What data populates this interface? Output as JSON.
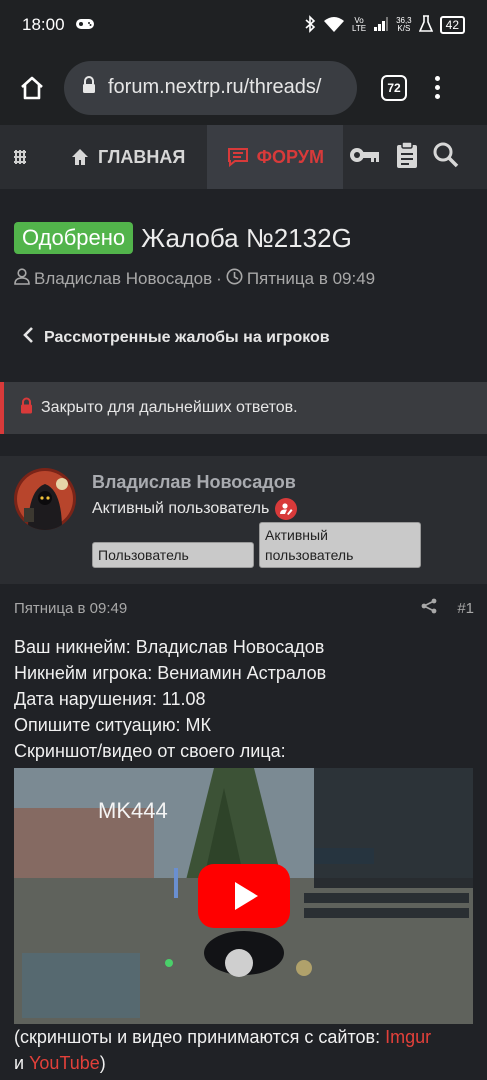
{
  "status_bar": {
    "time": "18:00",
    "net_top": "Vo",
    "net_bottom": "LTE",
    "speed_top": "36,3",
    "speed_bottom": "K/S",
    "battery": "42"
  },
  "browser": {
    "url": "forum.nextrp.ru/threads/",
    "tab_count": "72"
  },
  "nav": {
    "home_label": "ГЛАВНАЯ",
    "forum_label": "ФОРУМ"
  },
  "thread": {
    "status_badge": "Одобрено",
    "title": "Жалоба №2132G",
    "author": "Владислав Новосадов",
    "separator": "·",
    "date": "Пятница в 09:49"
  },
  "breadcrumb": {
    "label": "Рассмотренные жалобы на игроков"
  },
  "notice": {
    "text": "Закрыто для дальнейших ответов."
  },
  "post": {
    "author_name": "Владислав Новосадов",
    "author_role": "Активный пользователь",
    "tag_user": "Пользователь",
    "tag_active": "Активный пользователь",
    "date": "Пятница в 09:49",
    "number": "#1",
    "lines": [
      "Ваш никнейм: Владислав Новосадов",
      "Никнейм игрока: Вениамин Астралов",
      "Дата нарушения: 11.08",
      "Опишите ситуацию: МК",
      "Скриншот/видео от своего лица:"
    ],
    "video_overlay": "MK444",
    "footer_prefix": "(скриншоты и видео принимаются с сайтов: ",
    "footer_link1": "Imgur",
    "footer_and": "и ",
    "footer_link2": "YouTube",
    "footer_suffix": ")"
  },
  "colors": {
    "accent_red": "#d83a3a",
    "approved_green": "#52b44b",
    "bg": "#202226"
  }
}
